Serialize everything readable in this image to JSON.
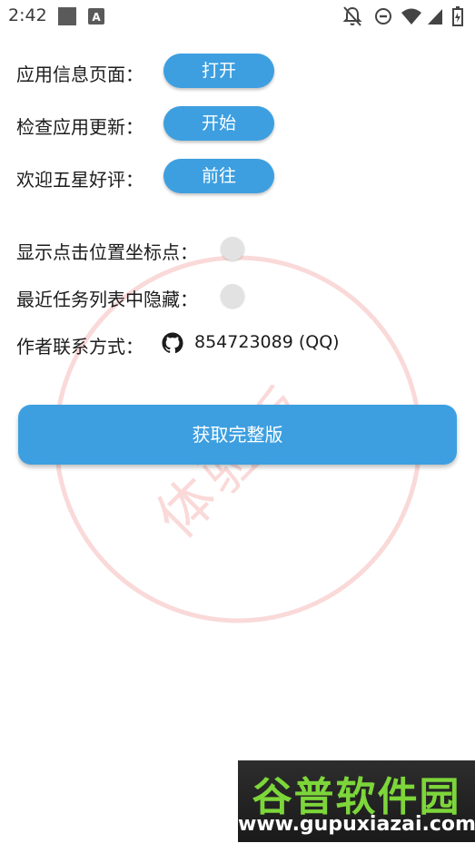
{
  "status_bar": {
    "time": "2:42",
    "icons": [
      "notification-app-icon",
      "a-app-icon",
      "bell-off-icon",
      "do-not-disturb-icon",
      "wifi-icon",
      "cell-signal-icon",
      "battery-icon"
    ]
  },
  "settings": [
    {
      "label": "应用信息页面：",
      "button": "打开"
    },
    {
      "label": "检查应用更新：",
      "button": "开始"
    },
    {
      "label": "欢迎五星好评：",
      "button": "前往"
    }
  ],
  "toggles": [
    {
      "label": "显示点击位置坐标点：",
      "state": "off"
    },
    {
      "label": "最近任务列表中隐藏：",
      "state": "off"
    }
  ],
  "contact": {
    "label": "作者联系方式：",
    "icon": "github-icon",
    "value": "854723089 (QQ)"
  },
  "main_button": "获取完整版",
  "watermark": "体验版",
  "site_logo": {
    "name": "谷普软件园",
    "url": "www.gupuxiazai.com"
  },
  "colors": {
    "accent": "#3d9fe0",
    "watermark": "#e65050",
    "toggle_off": "#e2e2e2"
  }
}
